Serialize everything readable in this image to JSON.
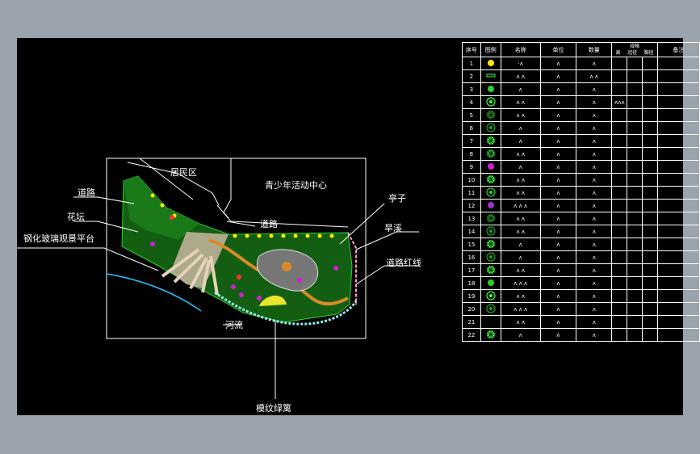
{
  "labels": {
    "residential": "居民区",
    "youth_center": "青少年活动中心",
    "road_left": "道路",
    "flowerbed": "花坛",
    "glass_platform": "钢化玻璃观景平台",
    "road_center": "道路",
    "pavilion": "亭子",
    "dry_creek": "旱溪",
    "road_red_line": "道路红线",
    "river": "河流",
    "pattern_hedge": "模纹绿篱"
  },
  "legend": {
    "headers": [
      "序号",
      "图例",
      "名称",
      "单位",
      "数量",
      "规格",
      "备注"
    ],
    "spec_sub": [
      "高",
      "冠径",
      "胸径"
    ],
    "rows": [
      {
        "index": "1",
        "name": "·ʌ",
        "unit": "ʌ",
        "qty": "ʌ",
        "spec": "",
        "symbol_color": "#ffea00",
        "symbol": "dot"
      },
      {
        "index": "2",
        "name": "ʌ ʌ",
        "unit": "ʌ",
        "qty": "ʌ ʌ",
        "spec": "",
        "symbol_color": "#3cff3c",
        "symbol": "bar"
      },
      {
        "index": "3",
        "name": "ʌ",
        "unit": "ʌ",
        "qty": "ʌ",
        "spec": "",
        "symbol_color": "#2bd12b",
        "symbol": "dot"
      },
      {
        "index": "4",
        "name": "ʌ ʌ",
        "unit": "ʌ",
        "qty": "ʌ",
        "spec": "ʌʌʌ",
        "symbol_color": "#3cff3c",
        "symbol": "ring"
      },
      {
        "index": "5",
        "name": "ʌ ʌ",
        "unit": "ʌ",
        "qty": "ʌ",
        "spec": "",
        "symbol_color": "#1ea01e",
        "symbol": "star"
      },
      {
        "index": "6",
        "name": "ʌ",
        "unit": "ʌ",
        "qty": "ʌ",
        "spec": "",
        "symbol_color": "#1ea01e",
        "symbol": "ring"
      },
      {
        "index": "7",
        "name": "ʌ",
        "unit": "ʌ",
        "qty": "ʌ",
        "spec": "",
        "symbol_color": "#3cff3c",
        "symbol": "star"
      },
      {
        "index": "8",
        "name": "ʌ ʌ",
        "unit": "ʌ",
        "qty": "ʌ",
        "spec": "",
        "symbol_color": "#2bd12b",
        "symbol": "star"
      },
      {
        "index": "9",
        "name": "ʌ",
        "unit": "ʌ",
        "qty": "ʌ",
        "spec": "",
        "symbol_color": "#d21ed2",
        "symbol": "dot"
      },
      {
        "index": "10",
        "name": "ʌ ʌ",
        "unit": "ʌ",
        "qty": "ʌ",
        "spec": "",
        "symbol_color": "#3cff3c",
        "symbol": "star"
      },
      {
        "index": "11",
        "name": "ʌ ʌ",
        "unit": "ʌ",
        "qty": "ʌ",
        "spec": "",
        "symbol_color": "#2bd12b",
        "symbol": "ring"
      },
      {
        "index": "12",
        "name": "ʌ ʌ ʌ",
        "unit": "ʌ",
        "qty": "ʌ",
        "spec": "",
        "symbol_color": "#a030d0",
        "symbol": "dot"
      },
      {
        "index": "13",
        "name": "ʌ ʌ",
        "unit": "ʌ",
        "qty": "ʌ",
        "spec": "",
        "symbol_color": "#1ea01e",
        "symbol": "star"
      },
      {
        "index": "14",
        "name": "ʌ ʌ",
        "unit": "ʌ",
        "qty": "ʌ",
        "spec": "",
        "symbol_color": "#1ea01e",
        "symbol": "ring"
      },
      {
        "index": "15",
        "name": "ʌ",
        "unit": "ʌ",
        "qty": "ʌ",
        "spec": "",
        "symbol_color": "#3cff3c",
        "symbol": "star"
      },
      {
        "index": "16",
        "name": "ʌ",
        "unit": "ʌ",
        "qty": "ʌ",
        "spec": "",
        "symbol_color": "#1ea01e",
        "symbol": "ring"
      },
      {
        "index": "17",
        "name": "ʌ ʌ",
        "unit": "ʌ",
        "qty": "ʌ",
        "spec": "",
        "symbol_color": "#3cff3c",
        "symbol": "star"
      },
      {
        "index": "18",
        "name": "ʌ ʌ ʌ",
        "unit": "ʌ",
        "qty": "ʌ",
        "spec": "",
        "symbol_color": "#2bd12b",
        "symbol": "dot"
      },
      {
        "index": "19",
        "name": "ʌ ʌ",
        "unit": "ʌ",
        "qty": "ʌ",
        "spec": "",
        "symbol_color": "#3cff3c",
        "symbol": "ring"
      },
      {
        "index": "20",
        "name": "ʌ ʌ ʌ",
        "unit": "ʌ",
        "qty": "ʌ",
        "spec": "",
        "symbol_color": "#1ea01e",
        "symbol": "ring"
      },
      {
        "index": "21",
        "name": "ʌ ʌ",
        "unit": "ʌ",
        "qty": "ʌ",
        "spec": "",
        "symbol_color": "",
        "symbol": "none"
      },
      {
        "index": "22",
        "name": "ʌ",
        "unit": "ʌ",
        "qty": "ʌ",
        "spec": "",
        "symbol_color": "#3cff3c",
        "symbol": "star"
      }
    ]
  },
  "colors": {
    "background_outer": "#9ba3ad",
    "canvas": "#000000",
    "line_white": "#ffffff",
    "green_plants": "#1f8a1f",
    "bright_green": "#3cff3c",
    "river_blue": "#1ec8ff",
    "path_orange": "#d88a2a"
  }
}
